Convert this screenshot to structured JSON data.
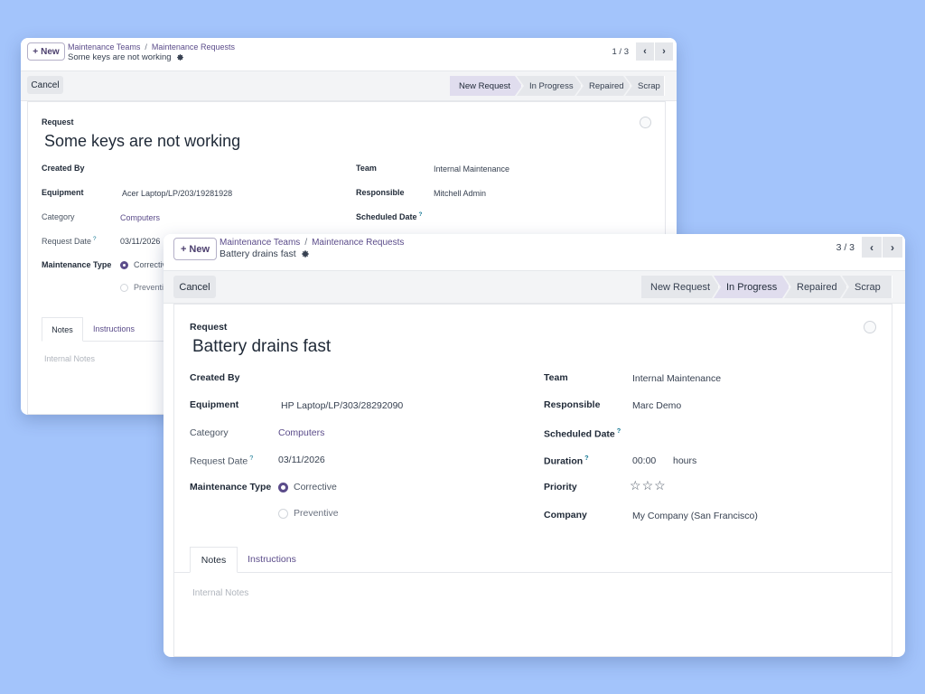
{
  "back_window": {
    "new_label": "New",
    "breadcrumb": {
      "parent": "Maintenance Teams",
      "sep": "/",
      "current": "Maintenance Requests"
    },
    "record_title": "Some keys are not working",
    "pager": "1 / 3",
    "cancel_label": "Cancel",
    "stages": [
      "New Request",
      "In Progress",
      "Repaired",
      "Scrap"
    ],
    "active_stage": "New Request",
    "request_label": "Request",
    "request_name": "Some keys are not working",
    "fields": {
      "created_by": {
        "label": "Created By",
        "value": ""
      },
      "equipment": {
        "label": "Equipment",
        "value": "Acer Laptop/LP/203/19281928"
      },
      "category": {
        "label": "Category",
        "value": "Computers"
      },
      "request_date": {
        "label": "Request Date",
        "help": "?",
        "value": "03/11/2026"
      },
      "maintenance_type": {
        "label": "Maintenance Type",
        "options": [
          "Corrective",
          "Preventive"
        ],
        "selected": "Corrective"
      },
      "team": {
        "label": "Team",
        "value": "Internal Maintenance"
      },
      "responsible": {
        "label": "Responsible",
        "value": "Mitchell Admin"
      },
      "scheduled_date": {
        "label": "Scheduled Date",
        "help": "?"
      }
    },
    "tabs": [
      "Notes",
      "Instructions"
    ],
    "notes_placeholder": "Internal Notes"
  },
  "front_window": {
    "new_label": "New",
    "breadcrumb": {
      "parent": "Maintenance Teams",
      "sep": "/",
      "current": "Maintenance Requests"
    },
    "record_title": "Battery drains fast",
    "pager": "3 / 3",
    "cancel_label": "Cancel",
    "stages": [
      "New Request",
      "In Progress",
      "Repaired",
      "Scrap"
    ],
    "active_stage": "In Progress",
    "request_label": "Request",
    "request_name": "Battery drains fast",
    "fields": {
      "created_by": {
        "label": "Created By",
        "value": ""
      },
      "equipment": {
        "label": "Equipment",
        "value": "HP Laptop/LP/303/28292090"
      },
      "category": {
        "label": "Category",
        "value": "Computers"
      },
      "request_date": {
        "label": "Request Date",
        "help": "?",
        "value": "03/11/2026"
      },
      "maintenance_type": {
        "label": "Maintenance Type",
        "options": [
          "Corrective",
          "Preventive"
        ],
        "selected": "Corrective"
      },
      "team": {
        "label": "Team",
        "value": "Internal Maintenance"
      },
      "responsible": {
        "label": "Responsible",
        "value": "Marc Demo"
      },
      "scheduled_date": {
        "label": "Scheduled Date",
        "help": "?"
      },
      "duration": {
        "label": "Duration",
        "help": "?",
        "value": "00:00",
        "unit": "hours"
      },
      "priority": {
        "label": "Priority",
        "stars": 3,
        "filled": 0
      },
      "company": {
        "label": "Company",
        "value": "My Company (San Francisco)"
      }
    },
    "tabs": [
      "Notes",
      "Instructions"
    ],
    "notes_placeholder": "Internal Notes"
  },
  "icons": {
    "plus": "plus-icon",
    "gear": "gear-icon",
    "prev": "chevron-left-icon",
    "next": "chevron-right-icon",
    "star": "star-outline-icon"
  },
  "colors": {
    "background": "#a3c4fb",
    "accent": "#5b4c8a",
    "active_stage": "#e0ddee"
  }
}
